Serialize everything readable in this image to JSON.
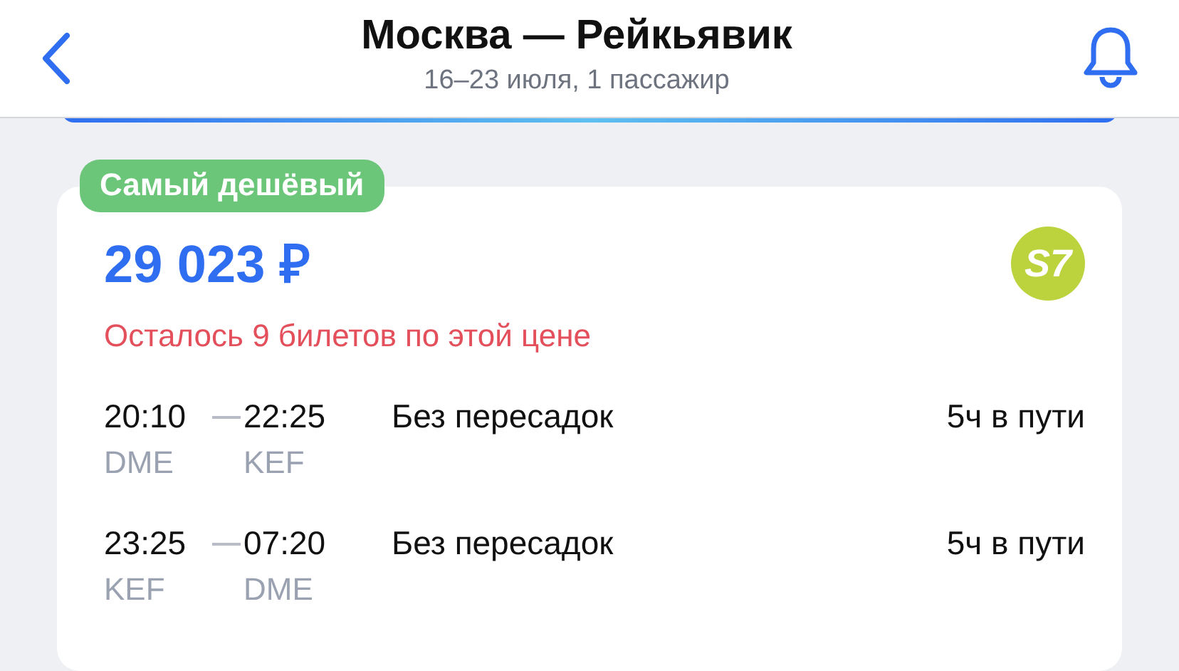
{
  "header": {
    "title": "Москва — Рейкьявик",
    "subtitle": "16–23 июля, 1 пассажир"
  },
  "offer": {
    "badge": "Самый дешёвый",
    "price": "29 023 ₽",
    "airline_logo": "S7",
    "warning": "Осталось 9 билетов по этой цене",
    "segments": [
      {
        "depart_time": "20:10",
        "arrive_time": "22:25",
        "depart_code": "DME",
        "arrive_code": "KEF",
        "stops": "Без пересадок",
        "duration": "5ч в пути"
      },
      {
        "depart_time": "23:25",
        "arrive_time": "07:20",
        "depart_code": "KEF",
        "arrive_code": "DME",
        "stops": "Без пересадок",
        "duration": "5ч в пути"
      }
    ]
  }
}
